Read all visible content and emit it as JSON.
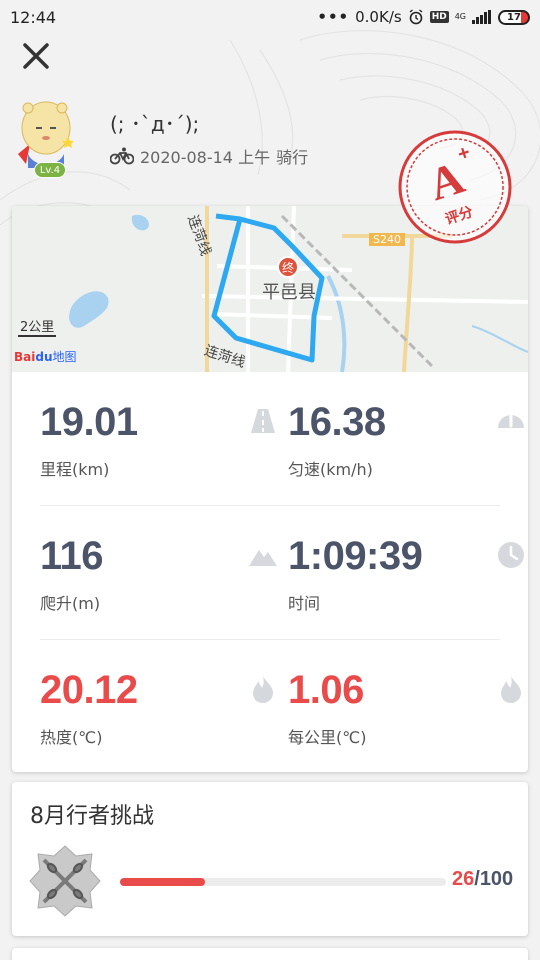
{
  "status_bar": {
    "time": "12:44",
    "network_speed": "0.0K/s",
    "hd_label": "HD",
    "network_type": "4G",
    "battery": "17",
    "icons": [
      "more-dots-icon",
      "alarm-icon",
      "hd-icon",
      "signal-icon",
      "battery-icon"
    ]
  },
  "header": {
    "close_icon": "close-icon",
    "user_name": "(; ･`д･´);",
    "level": "Lv.4",
    "activity_icon": "bicycle-icon",
    "datetime": "2020-08-14 上午",
    "activity_type": "骑行",
    "grade": "A",
    "grade_mark": "+",
    "grade_label": "评分"
  },
  "map": {
    "city_label": "平邑县",
    "road_label_1": "连菏线",
    "road_label_2": "连菏线",
    "highway_label": "S240",
    "end_marker": "终",
    "scale": "2公里",
    "logo_text_1": "Bai",
    "logo_text_2": "du",
    "logo_text_3": "地图",
    "route_color": "#2ea8f0"
  },
  "stats": [
    {
      "value": "19.01",
      "label": "里程(km)",
      "icon": "road-icon",
      "highlight": false
    },
    {
      "value": "16.38",
      "label": "匀速(km/h)",
      "icon": "speedometer-icon",
      "highlight": false
    },
    {
      "value": "116",
      "label": "爬升(m)",
      "icon": "mountain-icon",
      "highlight": false
    },
    {
      "value": "1:09:39",
      "label": "时间",
      "icon": "clock-icon",
      "highlight": false
    },
    {
      "value": "20.12",
      "label": "热度(℃)",
      "icon": "flame-icon",
      "highlight": true
    },
    {
      "value": "1.06",
      "label": "每公里(℃)",
      "icon": "flame-icon",
      "highlight": true
    }
  ],
  "challenge": {
    "title": "8月行者挑战",
    "badge_icon": "chain-badge-icon",
    "current": "26",
    "separator": "/",
    "total": "100",
    "progress_fraction": 0.26
  },
  "colors": {
    "accent_red": "#e94a4a",
    "value_gray": "#4b5468",
    "icon_gray": "#d5d8dd"
  }
}
